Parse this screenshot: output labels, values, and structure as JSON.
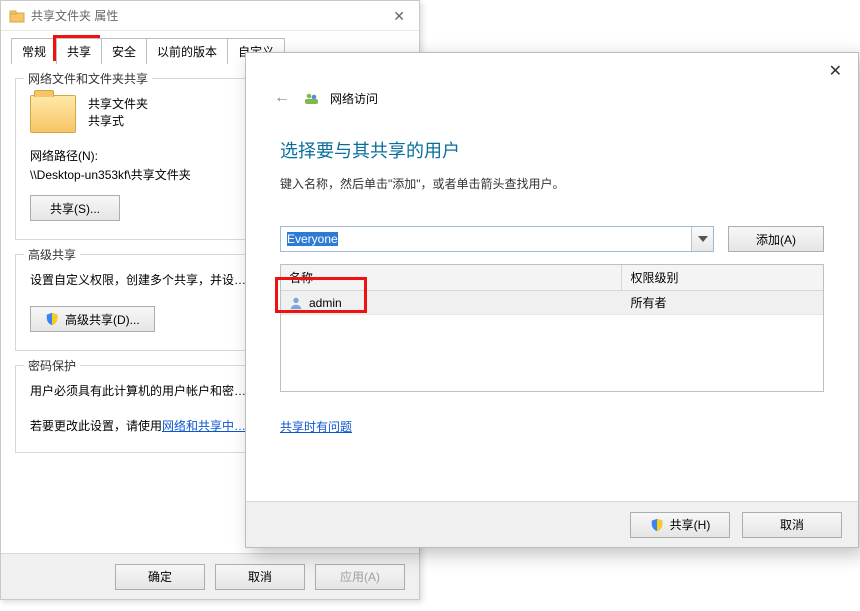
{
  "props": {
    "title": "共享文件夹 属性",
    "tabs": [
      "常规",
      "共享",
      "安全",
      "以前的版本",
      "自定义"
    ],
    "active_tab_index": 1,
    "group1": {
      "legend": "网络文件和文件夹共享",
      "folder_name": "共享文件夹",
      "share_mode": "共享式",
      "net_path_label": "网络路径(N):",
      "net_path_value": "\\\\Desktop-un353kf\\共享文件夹",
      "share_btn": "共享(S)..."
    },
    "group2": {
      "legend": "高级共享",
      "desc": "设置自定义权限，创建多个共享，并设…",
      "adv_btn": "高级共享(D)..."
    },
    "group3": {
      "legend": "密码保护",
      "line1": "用户必须具有此计算机的用户帐户和密…",
      "line2_prefix": "若要更改此设置，请使用",
      "line2_link": "网络和共享中…"
    },
    "footer": {
      "ok": "确定",
      "cancel": "取消",
      "apply": "应用(A)"
    }
  },
  "net": {
    "title": "网络访问",
    "big_title": "选择要与其共享的用户",
    "hint": "键入名称，然后单击\"添加\"，或者单击箭头查找用户。",
    "input_value": "Everyone",
    "add_btn": "添加(A)",
    "cols": {
      "name": "名称",
      "perm": "权限级别"
    },
    "rows": [
      {
        "name": "admin",
        "perm": "所有者"
      }
    ],
    "issue_link": "共享时有问题",
    "footer": {
      "share": "共享(H)",
      "cancel": "取消"
    }
  }
}
